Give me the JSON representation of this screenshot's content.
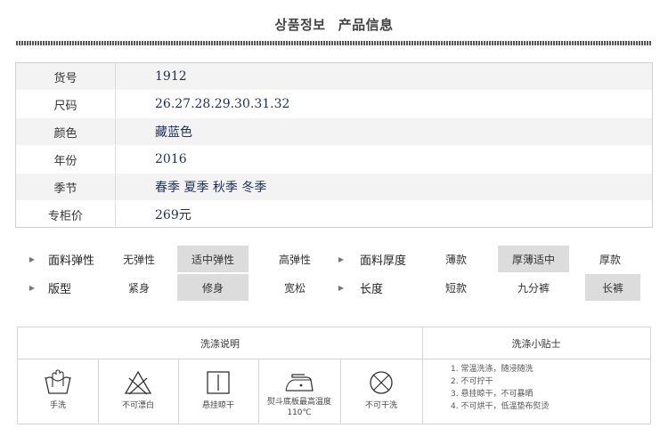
{
  "header": {
    "title_kr": "상품정보",
    "title_cn": "产品信息"
  },
  "product_info": [
    {
      "label": "货号",
      "value": "1912"
    },
    {
      "label": "尺码",
      "value": "26.27.28.29.30.31.32"
    },
    {
      "label": "颜色",
      "value": "藏蓝色"
    },
    {
      "label": "年份",
      "value": "2016"
    },
    {
      "label": "季节",
      "value": "春季 夏季 秋季 冬季"
    },
    {
      "label": "专柜价",
      "value": "269元"
    }
  ],
  "attributes": {
    "fabric_elasticity": {
      "label": "面料弹性",
      "options": [
        "无弹性",
        "适中弹性",
        "高弹性"
      ],
      "selected": "适中弹性"
    },
    "fabric_thickness": {
      "label": "面料厚度",
      "options": [
        "薄款",
        "厚薄适中",
        "厚款"
      ],
      "selected": "厚薄适中"
    },
    "fit": {
      "label": "版型",
      "options": [
        "紧身",
        "修身",
        "宽松"
      ],
      "selected": "修身"
    },
    "length": {
      "label": "长度",
      "options": [
        "短款",
        "九分裤",
        "长裤"
      ],
      "selected": "长裤"
    }
  },
  "washing": {
    "instructions_title": "洗涤说明",
    "tips_title": "洗涤小贴士",
    "icons": [
      {
        "name": "hand-wash-icon",
        "caption": "手洗"
      },
      {
        "name": "no-bleach-icon",
        "caption": "不可漂白"
      },
      {
        "name": "hang-dry-icon",
        "caption": "悬挂晾干"
      },
      {
        "name": "iron-icon",
        "caption": "熨斗底板最高温度110℃"
      },
      {
        "name": "no-dry-clean-icon",
        "caption": "不可干洗"
      }
    ],
    "tips": [
      "1. 常温洗涤，随浸随洗",
      "2. 不可拧干",
      "3. 悬挂晾干，不可暴晒",
      "4. 不可烘干，低温垫布熨烫"
    ]
  },
  "colors": {
    "value_text": "#1f2f5a",
    "selected_cell": "#dcdcdc",
    "shaded_row": "#f3f3f3"
  }
}
